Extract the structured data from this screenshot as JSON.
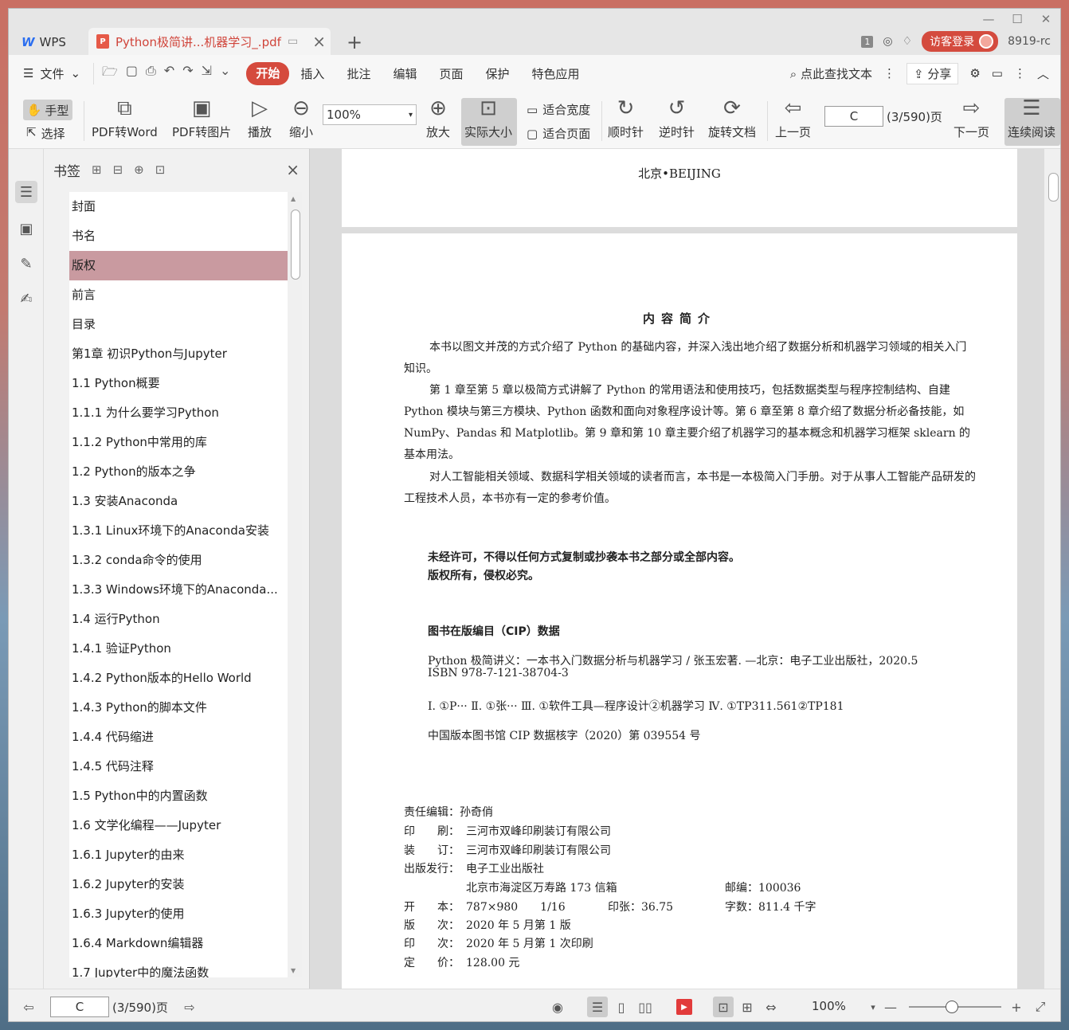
{
  "titlebar": {
    "app_tab": "WPS",
    "doc_tab": "Python极简讲...机器学习_.pdf",
    "user_id": "8919-rc",
    "login_label": "访客登录",
    "window_count": "1"
  },
  "menubar": {
    "file_label": "文件",
    "tabs": [
      "开始",
      "插入",
      "批注",
      "编辑",
      "页面",
      "保护",
      "特色应用"
    ],
    "search_label": "点此查找文本",
    "share_label": "分享"
  },
  "toolbar": {
    "hand_label": "手型",
    "select_label": "选择",
    "pdf_to_word": "PDF转Word",
    "pdf_to_image": "PDF转图片",
    "play_label": "播放",
    "zoom_out_label": "缩小",
    "zoom_value": "100%",
    "zoom_in_label": "放大",
    "actual_size_label": "实际大小",
    "fit_width_label": "适合宽度",
    "fit_page_label": "适合页面",
    "clockwise_label": "顺时针",
    "counter_clockwise_label": "逆时针",
    "rotate_doc_label": "旋转文档",
    "prev_page_label": "上一页",
    "page_input": "C",
    "page_info": "(3/590)页",
    "next_page_label": "下一页",
    "continuous_label": "连续阅读"
  },
  "panel": {
    "title": "书签",
    "items": [
      "封面",
      "书名",
      "版权",
      "前言",
      "目录",
      "第1章  初识Python与Jupyter",
      "1.1  Python概要",
      "1.1.1  为什么要学习Python",
      "1.1.2  Python中常用的库",
      "1.2  Python的版本之争",
      "1.3  安装Anaconda",
      "1.3.1  Linux环境下的Anaconda安装",
      "1.3.2  conda命令的使用",
      "1.3.3  Windows环境下的Anaconda...",
      "1.4  运行Python",
      "1.4.1  验证Python",
      "1.4.2  Python版本的Hello World",
      "1.4.3  Python的脚本文件",
      "1.4.4  代码缩进",
      "1.4.5  代码注释",
      "1.5  Python中的内置函数",
      "1.6  文学化编程——Jupyter",
      "1.6.1  Jupyter的由来",
      "1.6.2  Jupyter的安装",
      "1.6.3  Jupyter的使用",
      "1.6.4  Markdown编辑器",
      "1.7  Jupyter中的魔法函数"
    ],
    "selected_index": 2
  },
  "page": {
    "prev_page_city": "北京•BEIJING",
    "intro_title": "内容简介",
    "paragraphs": [
      "本书以图文并茂的方式介绍了 Python 的基础内容，并深入浅出地介绍了数据分析和机器学习领域的相关入门知识。",
      "第 1 章至第 5 章以极简方式讲解了 Python 的常用语法和使用技巧，包括数据类型与程序控制结构、自建 Python 模块与第三方模块、Python 函数和面向对象程序设计等。第 6 章至第 8 章介绍了数据分析必备技能，如 NumPy、Pandas 和 Matplotlib。第 9 章和第 10 章主要介绍了机器学习的基本概念和机器学习框架 sklearn 的基本用法。",
      "对人工智能相关领域、数据科学相关领域的读者而言，本书是一本极简入门手册。对于从事人工智能产品研发的工程技术人员，本书亦有一定的参考价值。"
    ],
    "copyright_1": "未经许可，不得以任何方式复制或抄袭本书之部分或全部内容。",
    "copyright_2": "版权所有，侵权必究。",
    "cip_title": "图书在版编目（CIP）数据",
    "cip_line_1": "Python 极简讲义：一本书入门数据分析与机器学习 / 张玉宏著. —北京：电子工业出版社，2020.5",
    "cip_line_2": "ISBN 978-7-121-38704-3",
    "cip_line_3": "Ⅰ. ①P··· Ⅱ. ①张··· Ⅲ. ①软件工具—程序设计②机器学习 Ⅳ. ①TP311.561②TP181",
    "cip_line_4": "中国版本图书馆 CIP 数据核字（2020）第 039554 号",
    "editor": "责任编辑：孙奇俏",
    "printer_label": "印　　刷：",
    "printer": "三河市双峰印刷装订有限公司",
    "binder_label": "装　　订：",
    "binder": "三河市双峰印刷装订有限公司",
    "publisher_label": "出版发行：",
    "publisher": "电子工业出版社",
    "address": "北京市海淀区万寿路 173 信箱",
    "postcode": "邮编：100036",
    "format_label": "开　　本：",
    "format": "787×980　　1/16",
    "sheets": "印张：36.75",
    "words": "字数：811.4 千字",
    "edition_label": "版　　次：",
    "edition": "2020 年 5 月第 1 版",
    "impression_label": "印　　次：",
    "impression": "2020 年 5 月第 1 次印刷",
    "price_label": "定　　价：",
    "price": "128.00 元"
  },
  "statusbar": {
    "page_input": "C",
    "page_info": "(3/590)页",
    "zoom_value": "100%"
  }
}
